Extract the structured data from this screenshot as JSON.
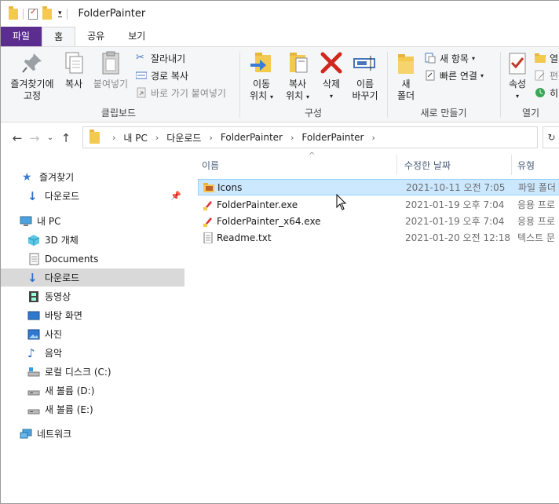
{
  "window": {
    "title": "FolderPainter"
  },
  "ribbon_tabs": [
    {
      "label": "파일"
    },
    {
      "label": "홈"
    },
    {
      "label": "공유"
    },
    {
      "label": "보기"
    }
  ],
  "ribbon": {
    "clipboard": {
      "pin_label": "즐겨찾기에\n고정",
      "pin_line1": "즐겨찾기에",
      "pin_line2": "고정",
      "copy": "복사",
      "paste": "붙여넣기",
      "cut": "잘라내기",
      "copy_path": "경로 복사",
      "paste_shortcut": "바로 가기 붙여넣기",
      "group_label": "클립보드"
    },
    "organize": {
      "move_line1": "이동",
      "move_line2": "위치",
      "copy_line1": "복사",
      "copy_line2": "위치",
      "delete": "삭제",
      "rename_line1": "이름",
      "rename_line2": "바꾸기",
      "group_label": "구성"
    },
    "new": {
      "new_folder_line1": "새",
      "new_folder_line2": "폴더",
      "new_item": "새 항목",
      "easy_access": "빠른 연결",
      "group_label": "새로 만들기"
    },
    "open": {
      "properties": "속성",
      "open": "열",
      "edit": "편",
      "history": "히",
      "group_label": "열기"
    }
  },
  "address": {
    "crumbs": [
      "내 PC",
      "다운로드",
      "FolderPainter",
      "FolderPainter"
    ]
  },
  "nav": {
    "items": [
      {
        "label": "즐겨찾기",
        "icon": "star-icon"
      },
      {
        "label": "다운로드",
        "icon": "download-icon",
        "pinned": true
      },
      {
        "label": "내 PC",
        "icon": "computer-icon"
      },
      {
        "label": "3D 개체",
        "icon": "cube-icon"
      },
      {
        "label": "Documents",
        "icon": "document-icon"
      },
      {
        "label": "다운로드",
        "icon": "download-icon",
        "selected": true
      },
      {
        "label": "동영상",
        "icon": "film-icon"
      },
      {
        "label": "바탕 화면",
        "icon": "desktop-icon"
      },
      {
        "label": "사진",
        "icon": "picture-icon"
      },
      {
        "label": "음악",
        "icon": "music-icon"
      },
      {
        "label": "로컬 디스크 (C:)",
        "icon": "drive-icon"
      },
      {
        "label": "새 볼륨 (D:)",
        "icon": "drive-icon"
      },
      {
        "label": "새 볼륨 (E:)",
        "icon": "drive-icon"
      },
      {
        "label": "네트워크",
        "icon": "network-icon"
      }
    ]
  },
  "columns": {
    "name": "이름",
    "modified": "수정한 날짜",
    "type": "유형"
  },
  "files": [
    {
      "name": "Icons",
      "modified": "2021-10-11 오전 7:05",
      "type": "파일 폴더",
      "icon": "folder-icon"
    },
    {
      "name": "FolderPainter.exe",
      "modified": "2021-01-19 오후 7:04",
      "type": "응용 프로",
      "icon": "app-icon"
    },
    {
      "name": "FolderPainter_x64.exe",
      "modified": "2021-01-19 오후 7:04",
      "type": "응용 프로",
      "icon": "app-icon"
    },
    {
      "name": "Readme.txt",
      "modified": "2021-01-20 오전 12:18",
      "type": "텍스트 문",
      "icon": "text-file-icon"
    }
  ],
  "colors": {
    "file_tab": "#5b2d8e",
    "selection": "#d9d9d9",
    "hover": "#cce8ff",
    "folder": "#f3c94f",
    "header_text": "#4c607a"
  }
}
